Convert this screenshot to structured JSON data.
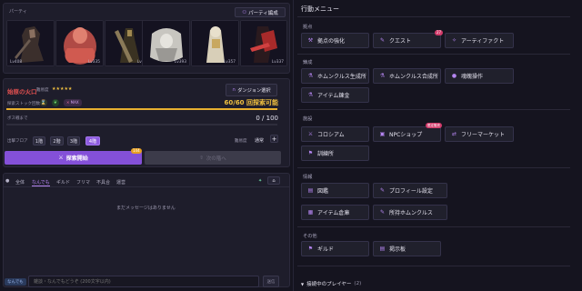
{
  "party": {
    "title": "パーティ",
    "edit_button": "パーティ編成",
    "members": [
      {
        "level": "Lv408",
        "level_side": "left"
      },
      {
        "level": "Lv335",
        "level_side": "right"
      },
      {
        "level": "Lv346",
        "level_side": "right"
      },
      {
        "level": "Lv393",
        "level_side": "right"
      },
      {
        "level": "Lv357",
        "level_side": "right"
      },
      {
        "level": "Lv337",
        "level_side": "right"
      }
    ]
  },
  "dungeon": {
    "name": "始原の火口",
    "difficulty_label": "難易度",
    "stars": "★★★★★",
    "select_button": "ダンジョン選択",
    "stock_label": "探索ストック回数",
    "max_tag": "MAX",
    "stock_value": "60/60",
    "stock_note": "回探索可能",
    "stock_fraction": 1.0,
    "boss_label": "ボス戦まで",
    "boss_value": "0 / 100",
    "boss_fraction": 0.0,
    "floor_label": "出撃フロア",
    "floors": [
      "1階",
      "2階",
      "3階",
      "4階"
    ],
    "selected_floor": "4階",
    "difficulty_mode_label": "難易度",
    "difficulty_mode_value": "通常",
    "plus": "+",
    "start_button": "探索開始",
    "start_badge": "144",
    "next_button": "次の階へ"
  },
  "chat": {
    "tabs": [
      "全体",
      "なんでも",
      "ギルド",
      "フリマ",
      "不具合",
      "運営"
    ],
    "active_tab": "なんでも",
    "empty_message": "まだメッセージはありません",
    "channel_tag": "なんでも",
    "input_placeholder": "雑談・なんでもどうぞ (200文字以内)",
    "send_button": "送信"
  },
  "menu": {
    "title": "行動メニュー",
    "sections": [
      {
        "title": "拠点",
        "items": [
          "拠点の強化",
          "クエスト",
          "アーティファクト"
        ],
        "quest_badge": "27"
      },
      {
        "title": "錬成",
        "items": [
          "ホムンクルス生成所",
          "ホムンクルス合成所",
          "魂魄操作",
          "アイテム錬金"
        ]
      },
      {
        "title": "施設",
        "items": [
          "コロシアム",
          "NPCショップ",
          "フリーマーケット",
          "訓練所"
        ],
        "shop_badge": "限定販売"
      },
      {
        "title": "情報",
        "items": [
          "図鑑",
          "プロフィール設定",
          "アイテム倉庫",
          "所持ホムンクルス"
        ]
      },
      {
        "title": "その他",
        "items": [
          "ギルド",
          "掲示板"
        ]
      }
    ],
    "online_label": "接続中のプレイヤー",
    "online_count": "(2)"
  },
  "colors": {
    "accent": "#8e5ce0",
    "bg": "#15141f",
    "gold": "#f0c040"
  }
}
